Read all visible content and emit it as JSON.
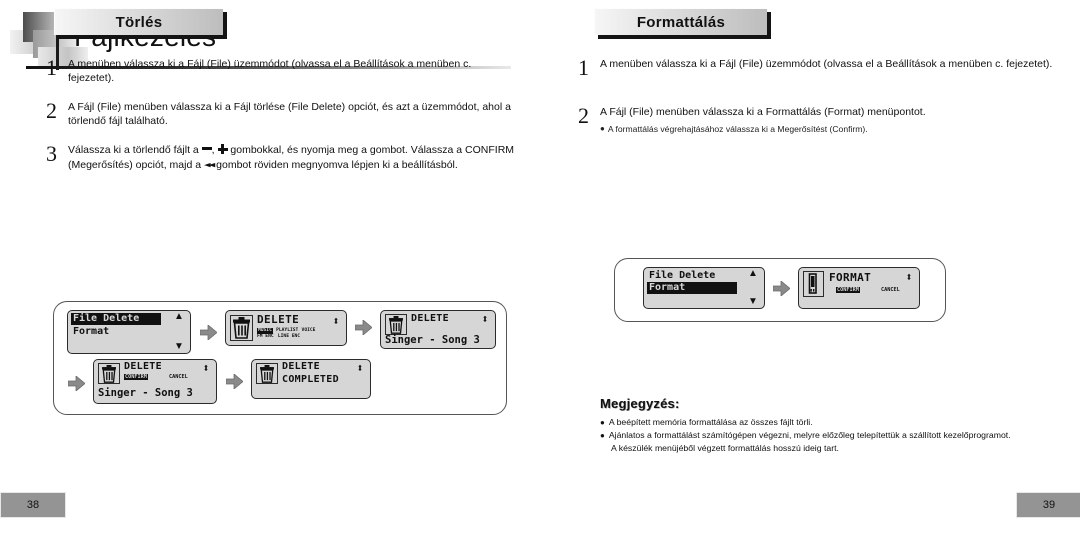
{
  "document": {
    "title": "Fájlkezelés"
  },
  "left_page": {
    "section_title": "Törlés",
    "page_number": "38",
    "steps": [
      {
        "num": "1",
        "text": "A menüben válassza ki a Fájl (File) üzemmódot (olvassa el a Beállítások a menüben c. fejezetet)."
      },
      {
        "num": "2",
        "text": "A Fájl (File) menüben válassza ki a Fájl törlése (File Delete) opciót, és azt a üzemmódot, ahol a törlendő fájl található."
      },
      {
        "num": "3",
        "text_part1": "Válassza ki a törlendő fájlt a ",
        "text_part2": " gombokkal, és nyomja meg a  gombot. Válassza a CONFIRM (Megerősítés) opciót, majd a ",
        "prev_glyph": "◄◄",
        "text_part3": " gombot röviden megnyomva lépjen ki a beállításból."
      }
    ],
    "diagram": {
      "screen1": {
        "menu_items": [
          "File Delete",
          "Format"
        ],
        "selected": "File Delete",
        "up_arrow": "▲",
        "down_arrow": "▼"
      },
      "screen2": {
        "icon": "trash-icon",
        "heading": "DELETE",
        "modes_row1": [
          "MUSIC",
          "PLAYLIST",
          "VOICE"
        ],
        "modes_row2": [
          "FM ENC",
          "LINE ENC"
        ],
        "selected_mode": "MUSIC",
        "updown": "⬍"
      },
      "screen3": {
        "icon": "trash-icon",
        "heading": "DELETE",
        "filename": "Singer - Song 3",
        "updown": "⬍"
      },
      "screen4": {
        "icon": "trash-icon",
        "heading": "DELETE",
        "confirm_label": "CONFIRM",
        "cancel_label": "CANCEL",
        "selected_action": "CONFIRM",
        "filename": "Singer - Song 3",
        "updown": "⬍"
      },
      "screen5": {
        "icon": "trash-icon",
        "heading": "DELETE",
        "status": "COMPLETED",
        "updown": "⬍"
      }
    }
  },
  "right_page": {
    "section_title": "Formattálás",
    "page_number": "39",
    "steps": [
      {
        "num": "1",
        "text": "A menüben válassza ki a Fájl (File) üzemmódot (olvassa el a Beállítások a menüben c. fejezetet)."
      },
      {
        "num": "2",
        "text": "A Fájl (File) menüben válassza ki a Formattálás (Format) menüpontot.",
        "sub": "A formattálás végrehajtásához válassza ki a Megerősítést (Confirm)."
      }
    ],
    "diagram": {
      "screen1": {
        "menu_items": [
          "File Delete",
          "Format"
        ],
        "selected": "Format",
        "up_arrow": "▲",
        "down_arrow": "▼"
      },
      "screen2": {
        "icon": "memory-icon",
        "heading": "FORMAT",
        "confirm_label": "CONFIRM",
        "cancel_label": "CANCEL",
        "selected_action": "CONFIRM",
        "updown": "⬍"
      }
    },
    "note": {
      "title": "Megjegyzés:",
      "items": [
        "A beépített memória formattálása az összes fájlt törli.",
        "Ajánlatos a formattálást számítógépen végezni, melyre előzőleg telepítettük a szállított kezelőprogramot."
      ],
      "continuation": "A készülék menüjéből végzett formattálás hosszú ideig tart."
    }
  },
  "colors": {
    "lcd_background": "#d6d6d6",
    "lcd_border": "#2b2b2b",
    "page_badge": "#949494",
    "ink": "#111111"
  }
}
